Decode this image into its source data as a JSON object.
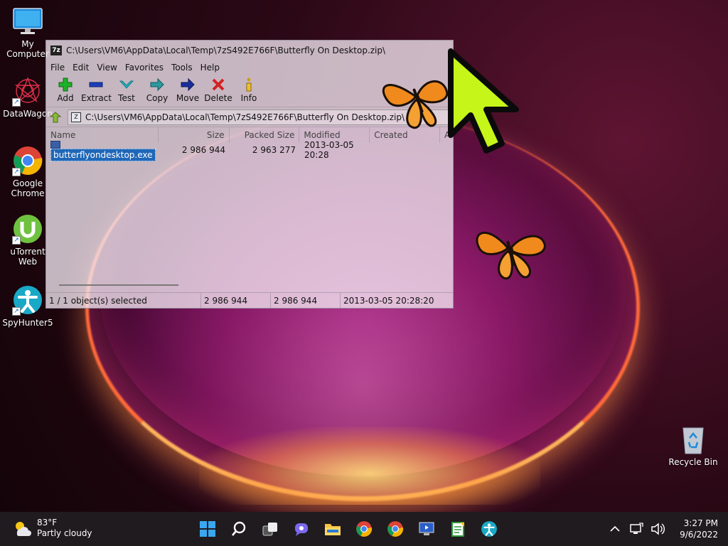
{
  "desktop": {
    "icons": [
      {
        "label": "My Computer"
      },
      {
        "label": "DataWagon"
      },
      {
        "label": "Google Chrome"
      },
      {
        "label": "uTorrent Web"
      },
      {
        "label": "SpyHunter5"
      },
      {
        "label": "Recycle Bin"
      }
    ]
  },
  "window": {
    "title": "C:\\Users\\VM6\\AppData\\Local\\Temp\\7zS492E766F\\Butterfly On Desktop.zip\\",
    "app_icon_text": "7z",
    "menu": [
      "File",
      "Edit",
      "View",
      "Favorites",
      "Tools",
      "Help"
    ],
    "toolbar": {
      "add": "Add",
      "extract": "Extract",
      "test": "Test",
      "copy": "Copy",
      "move": "Move",
      "delete": "Delete",
      "info": "Info"
    },
    "address": "C:\\Users\\VM6\\AppData\\Local\\Temp\\7zS492E766F\\Butterfly On Desktop.zip\\",
    "columns": {
      "name": "Name",
      "size": "Size",
      "packed": "Packed Size",
      "modified": "Modified",
      "created": "Created",
      "a": "A"
    },
    "files": [
      {
        "name": "butterflyondesktop.exe",
        "size": "2 986 944",
        "packed": "2 963 277",
        "modified": "2013-03-05 20:28",
        "created": ""
      }
    ],
    "status": {
      "selection": "1 / 1 object(s) selected",
      "size": "2 986 944",
      "packed": "2 986 944",
      "modified": "2013-03-05 20:28:20"
    }
  },
  "taskbar": {
    "weather": {
      "temp": "83°F",
      "desc": "Partly cloudy"
    },
    "clock": {
      "time": "3:27 PM",
      "date": "9/6/2022"
    }
  },
  "colors": {
    "selection": "#1f67b8",
    "cursor": "#c6f51a",
    "butterfly": "#f08a1c",
    "taskbar": "#1f1b1f"
  }
}
